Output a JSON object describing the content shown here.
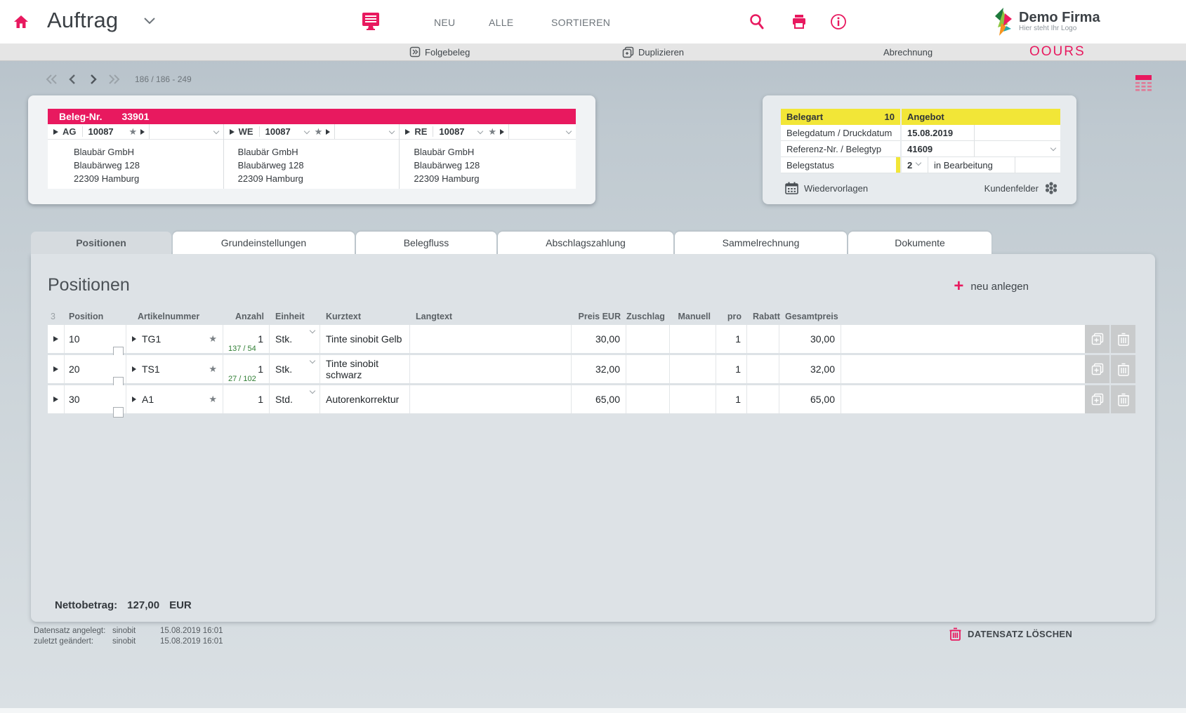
{
  "colors": {
    "accent": "#e8195f",
    "yellow": "#f2e637",
    "stock_green": "#2e7d32"
  },
  "icons": {
    "star": "★"
  },
  "header": {
    "title": "Auftrag",
    "neu": "NEU",
    "alle": "ALLE",
    "sortieren": "SORTIEREN",
    "logo_name": "Demo Firma",
    "logo_tagline": "Hier steht Ihr Logo"
  },
  "toolbar": {
    "folgebeleg": "Folgebeleg",
    "duplizieren": "Duplizieren",
    "abrechnung": "Abrechnung",
    "brand": "OOURS"
  },
  "record_nav": {
    "position": "186 / 186 - 249"
  },
  "beleg_card": {
    "label": "Beleg-Nr.",
    "number": "33901",
    "parties": [
      {
        "code": "AG",
        "id": "10087",
        "address": [
          "Blaubär GmbH",
          "Blaubärweg 128",
          "22309 Hamburg"
        ]
      },
      {
        "code": "WE",
        "id": "10087",
        "address": [
          "Blaubär GmbH",
          "Blaubärweg 128",
          "22309 Hamburg"
        ]
      },
      {
        "code": "RE",
        "id": "10087",
        "address": [
          "Blaubär GmbH",
          "Blaubärweg 128",
          "22309 Hamburg"
        ]
      }
    ]
  },
  "beleg_info": {
    "header_label": "Belegart",
    "header_value": "10",
    "header_value2": "Angebot",
    "rows": [
      {
        "label": "Belegdatum / Druckdatum",
        "value": "15.08.2019",
        "value2": ""
      },
      {
        "label": "Referenz-Nr. / Belegtyp",
        "value": "41609",
        "value2": ""
      },
      {
        "label": "Belegstatus",
        "value": "2",
        "value2": "in Bearbeitung"
      }
    ],
    "wiedervorlagen": "Wiedervorlagen",
    "kundenfelder": "Kundenfelder"
  },
  "tabs": [
    {
      "label": "Positionen"
    },
    {
      "label": "Grundeinstellungen"
    },
    {
      "label": "Belegfluss"
    },
    {
      "label": "Abschlagszahlung"
    },
    {
      "label": "Sammelrechnung"
    },
    {
      "label": "Dokumente"
    }
  ],
  "positions": {
    "heading": "Positionen",
    "add_button": "neu anlegen",
    "count": "3",
    "columns": [
      "Position",
      "Artikelnummer",
      "Anzahl",
      "Einheit",
      "Kurztext",
      "Langtext",
      "Preis EUR",
      "Zuschlag",
      "Manuell",
      "pro",
      "Rabatt",
      "Gesamtpreis"
    ],
    "rows": [
      {
        "position": "10",
        "artikelnummer": "TG1",
        "anzahl": "1",
        "stock": "137 / 54",
        "einheit": "Stk.",
        "kurztext": "Tinte sinobit Gelb",
        "langtext": "",
        "preis": "30,00",
        "zuschlag": "",
        "manuell": "",
        "pro": "1",
        "rabatt": "",
        "gesamtpreis": "30,00"
      },
      {
        "position": "20",
        "artikelnummer": "TS1",
        "anzahl": "1",
        "stock": "27 / 102",
        "einheit": "Stk.",
        "kurztext": "Tinte sinobit schwarz",
        "langtext": "",
        "preis": "32,00",
        "zuschlag": "",
        "manuell": "",
        "pro": "1",
        "rabatt": "",
        "gesamtpreis": "32,00"
      },
      {
        "position": "30",
        "artikelnummer": "A1",
        "anzahl": "1",
        "stock": "",
        "einheit": "Std.",
        "kurztext": "Autorenkorrektur",
        "langtext": "",
        "preis": "65,00",
        "zuschlag": "",
        "manuell": "",
        "pro": "1",
        "rabatt": "",
        "gesamtpreis": "65,00"
      }
    ],
    "total_label": "Nettobetrag:",
    "total_value": "127,00",
    "total_currency": "EUR"
  },
  "footer": {
    "created_label": "Datensatz angelegt:",
    "created_user": "sinobit",
    "created_at": "15.08.2019 16:01",
    "modified_label": "zuletzt geändert:",
    "modified_user": "sinobit",
    "modified_at": "15.08.2019 16:01",
    "delete_button": "DATENSATZ LÖSCHEN"
  }
}
